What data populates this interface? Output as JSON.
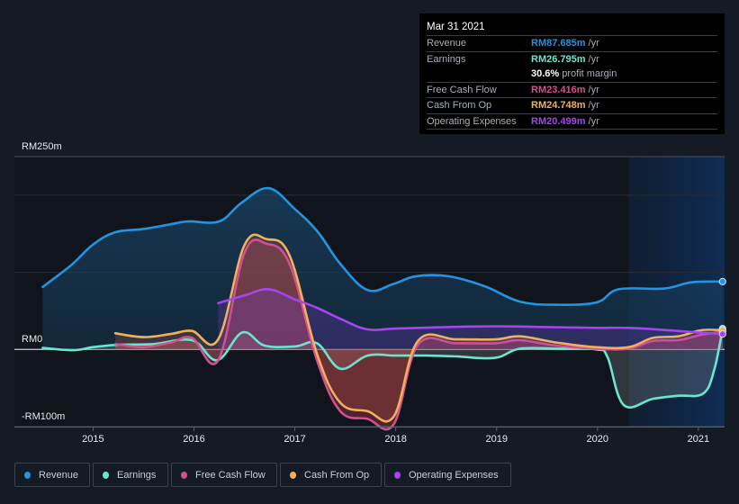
{
  "tooltip": {
    "date": "Mar 31 2021",
    "rows": [
      {
        "label": "Revenue",
        "value": "RM87.685m",
        "unit": "/yr",
        "color": "#2394df"
      },
      {
        "label": "Earnings",
        "value": "RM26.795m",
        "unit": "/yr",
        "color": "#6ce5d0"
      },
      {
        "label": "",
        "value": "30.6%",
        "unit": "profit margin",
        "color": "#ffffff"
      },
      {
        "label": "Free Cash Flow",
        "value": "RM23.416m",
        "unit": "/yr",
        "color": "#d2508e"
      },
      {
        "label": "Cash From Op",
        "value": "RM24.748m",
        "unit": "/yr",
        "color": "#f0b15c"
      },
      {
        "label": "Operating Expenses",
        "value": "RM20.499m",
        "unit": "/yr",
        "color": "#a445ee"
      }
    ]
  },
  "legend": [
    {
      "label": "Revenue",
      "color": "#2394df"
    },
    {
      "label": "Earnings",
      "color": "#6ce5d0"
    },
    {
      "label": "Free Cash Flow",
      "color": "#d2508e"
    },
    {
      "label": "Cash From Op",
      "color": "#f0b15c"
    },
    {
      "label": "Operating Expenses",
      "color": "#a445ee"
    }
  ],
  "chart_data": {
    "type": "area",
    "title": "",
    "xlabel": "",
    "ylabel": "",
    "ylim": [
      -100,
      250
    ],
    "xlim": [
      2014.22,
      2021.26
    ],
    "y_tick_labels": [
      {
        "value": 250,
        "label": "RM250m"
      },
      {
        "value": 0,
        "label": "RM0"
      },
      {
        "value": -100,
        "label": "-RM100m"
      }
    ],
    "gridlines": [
      250,
      200,
      100,
      0,
      -100
    ],
    "x_ticks": [
      2015,
      2016,
      2017,
      2018,
      2019,
      2020,
      2021
    ],
    "x_tick_labels": [
      "2015",
      "2016",
      "2017",
      "2018",
      "2019",
      "2020",
      "2021"
    ],
    "highlight_from": 2020.31,
    "series": [
      {
        "name": "Revenue",
        "color": "#2394df",
        "x": [
          2014.5,
          2014.78,
          2015.0,
          2015.22,
          2015.49,
          2015.76,
          2015.94,
          2016.25,
          2016.47,
          2016.74,
          2017.0,
          2017.23,
          2017.45,
          2017.72,
          2017.98,
          2018.2,
          2018.52,
          2018.88,
          2019.23,
          2019.59,
          2019.99,
          2020.21,
          2020.66,
          2020.93,
          2021.24
        ],
        "y": [
          81,
          109,
          136,
          152,
          156,
          162,
          166,
          166,
          190,
          209,
          182,
          152,
          111,
          77,
          85,
          95,
          95,
          82,
          62,
          58,
          61,
          78,
          79,
          87,
          88
        ]
      },
      {
        "name": "Earnings",
        "color": "#6ce5d0",
        "x": [
          2014.5,
          2014.8,
          2015.0,
          2015.25,
          2015.6,
          2015.98,
          2016.23,
          2016.48,
          2016.7,
          2017.0,
          2017.22,
          2017.45,
          2017.72,
          2018.0,
          2018.3,
          2018.6,
          2018.98,
          2019.23,
          2019.6,
          2019.99,
          2020.1,
          2020.26,
          2020.55,
          2020.8,
          2021.05,
          2021.16,
          2021.24
        ],
        "y": [
          2,
          -1,
          3,
          6,
          7,
          12,
          -14,
          22,
          5,
          4,
          8,
          -25,
          -8,
          -8,
          -8,
          -9,
          -11,
          1,
          1,
          0,
          -10,
          -72,
          -64,
          -60,
          -57,
          -25,
          27
        ]
      },
      {
        "name": "Free Cash Flow",
        "color": "#d2508e",
        "x": [
          2015.22,
          2015.5,
          2015.77,
          2015.98,
          2016.24,
          2016.5,
          2016.72,
          2016.95,
          2017.22,
          2017.45,
          2017.72,
          2017.98,
          2018.22,
          2018.6,
          2018.99,
          2019.23,
          2019.59,
          2019.98,
          2020.31,
          2020.55,
          2020.8,
          2021.03,
          2021.24
        ],
        "y": [
          7,
          3,
          9,
          15,
          -14,
          125,
          137,
          110,
          -14,
          -80,
          -90,
          -97,
          6,
          8,
          8,
          12,
          5,
          1,
          1,
          11,
          12,
          19,
          23
        ]
      },
      {
        "name": "Cash From Op",
        "color": "#f0b15c",
        "x": [
          2015.22,
          2015.5,
          2015.77,
          2015.98,
          2016.24,
          2016.5,
          2016.72,
          2016.95,
          2017.22,
          2017.45,
          2017.72,
          2017.98,
          2018.22,
          2018.6,
          2018.99,
          2019.23,
          2019.59,
          2019.98,
          2020.31,
          2020.55,
          2020.8,
          2021.03,
          2021.24
        ],
        "y": [
          21,
          16,
          20,
          24,
          13,
          135,
          143,
          121,
          -6,
          -69,
          -80,
          -87,
          11,
          13,
          13,
          17,
          9,
          3,
          3,
          15,
          17,
          25,
          25
        ]
      },
      {
        "name": "Operating Expenses",
        "color": "#a445ee",
        "x": [
          2016.24,
          2016.5,
          2016.74,
          2017.0,
          2017.22,
          2017.48,
          2017.72,
          2018.0,
          2018.5,
          2019.0,
          2019.5,
          2019.98,
          2020.31,
          2020.7,
          2021.0,
          2021.24
        ],
        "y": [
          60,
          70,
          78,
          65,
          54,
          38,
          26,
          27,
          29,
          30,
          29,
          28,
          28,
          25,
          22,
          20
        ]
      }
    ]
  }
}
